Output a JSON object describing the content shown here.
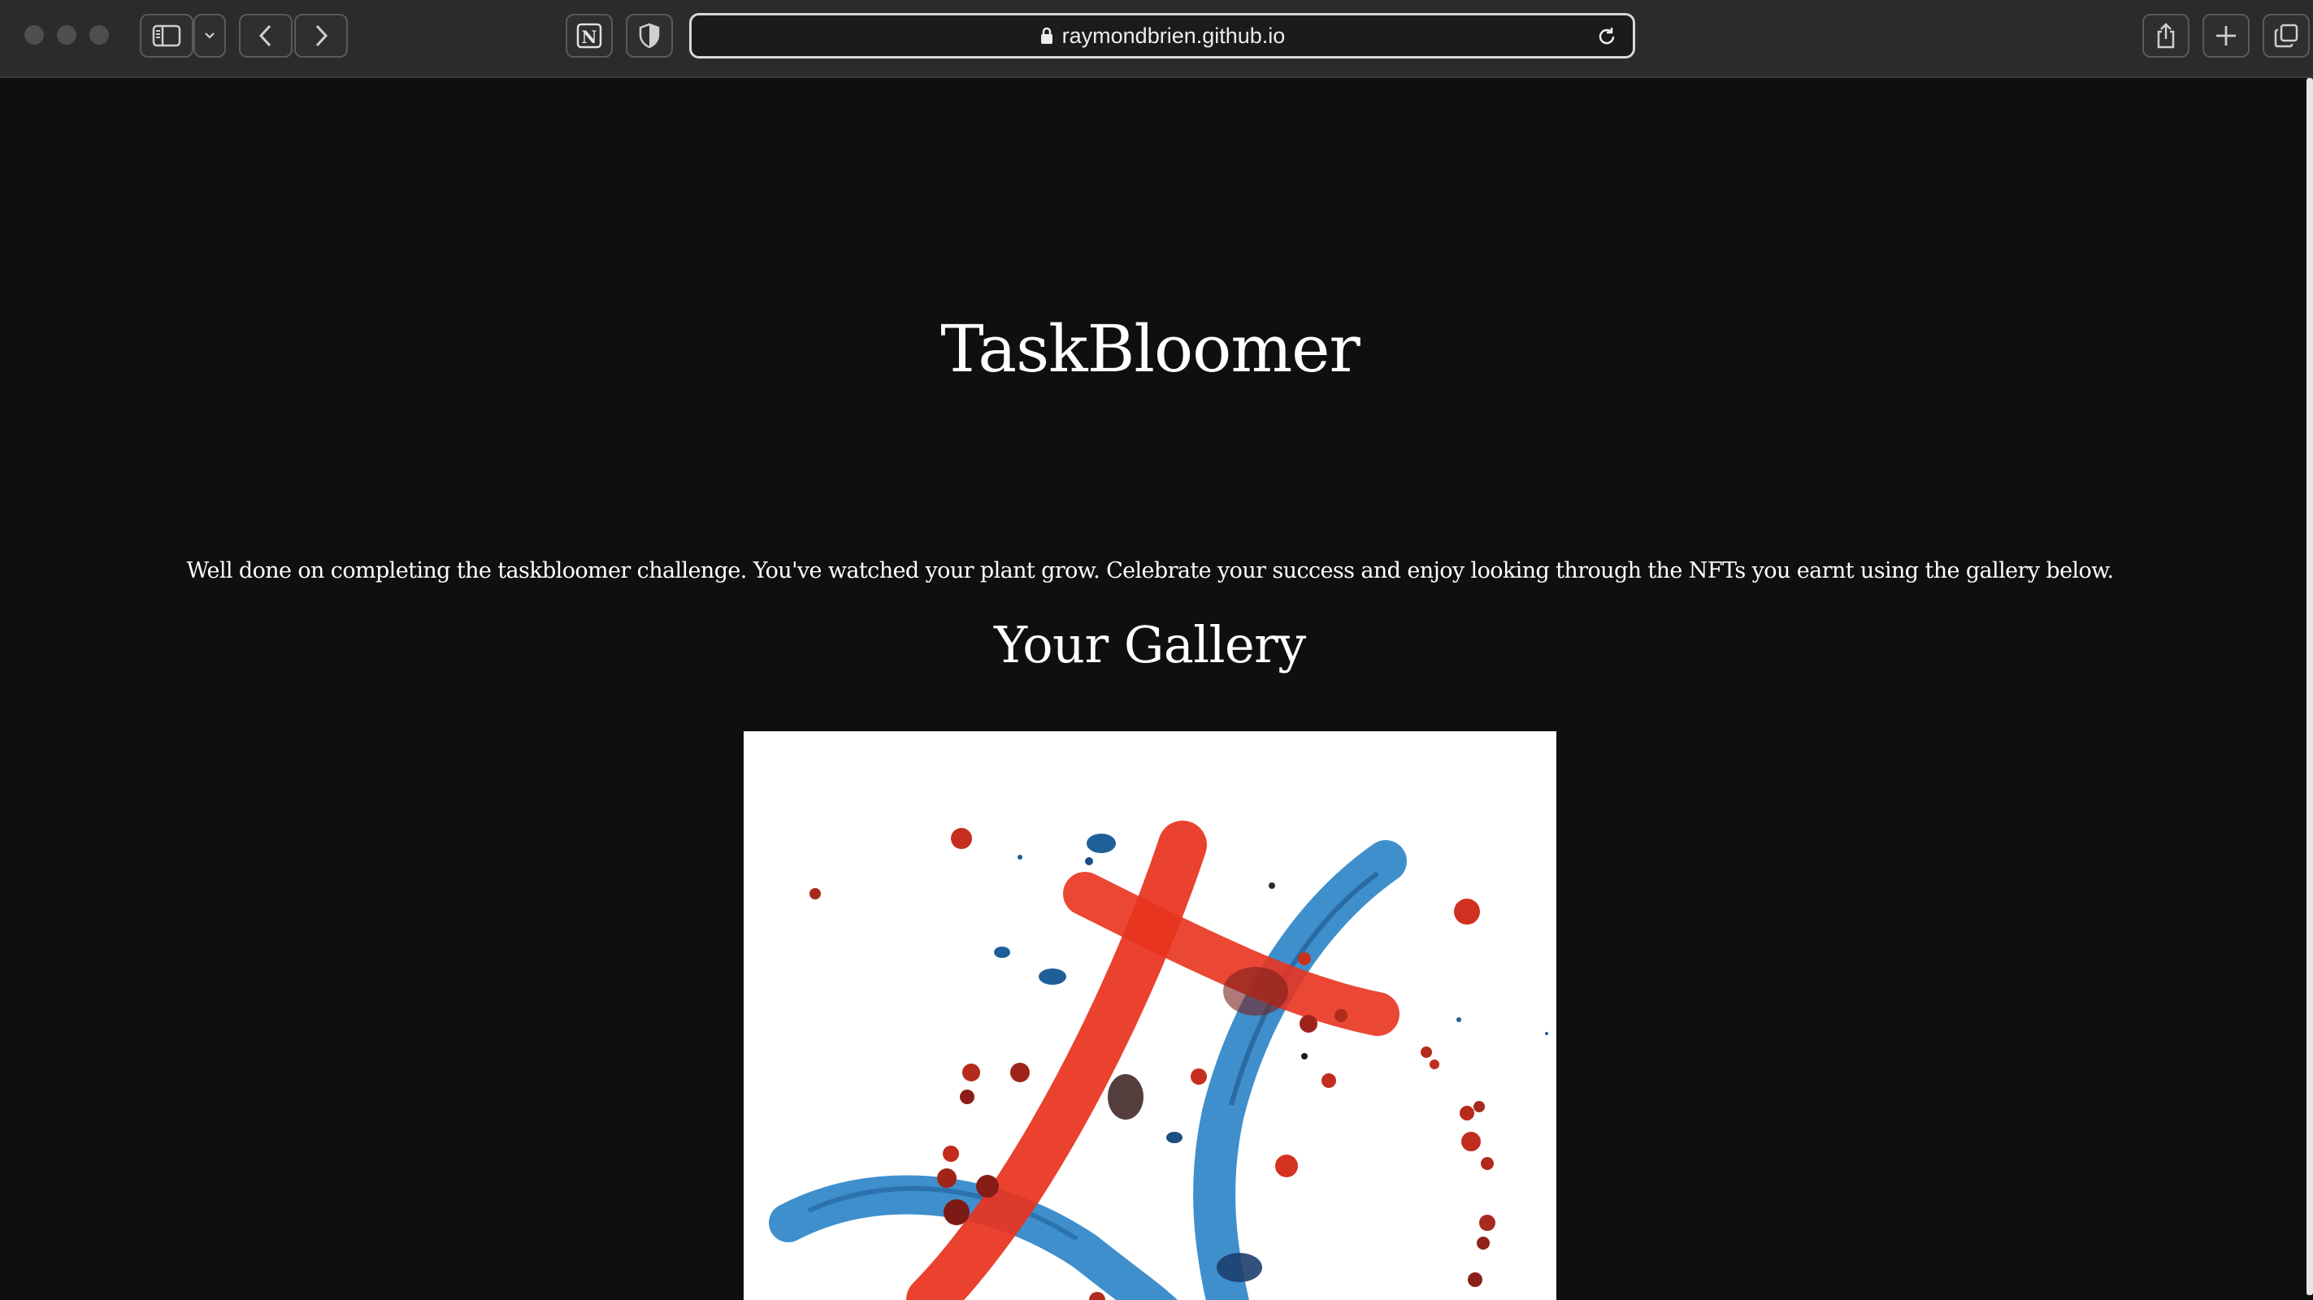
{
  "browser": {
    "url": "raymondbrien.github.io",
    "icons": {
      "sidebar": "sidebar-icon",
      "back": "chevron-left-icon",
      "forward": "chevron-right-icon",
      "notion": "notion-icon",
      "privacy": "shield-icon",
      "lock": "lock-icon",
      "reload": "reload-icon",
      "share": "share-icon",
      "new_tab": "plus-icon",
      "tabs": "tabs-overview-icon"
    }
  },
  "page": {
    "title": "TaskBloomer",
    "intro": "Well done on completing the taskbloomer challenge. You've watched your plant grow. Celebrate your success and enjoy looking through the NFTs you earnt using the gallery below.",
    "gallery_heading": "Your Gallery"
  },
  "colors": {
    "page_background": "#0e1010",
    "text": "#ffffff",
    "toolbar": "#2b2b2b",
    "art_red": "#e8341f",
    "art_blue": "#2f86c9"
  }
}
